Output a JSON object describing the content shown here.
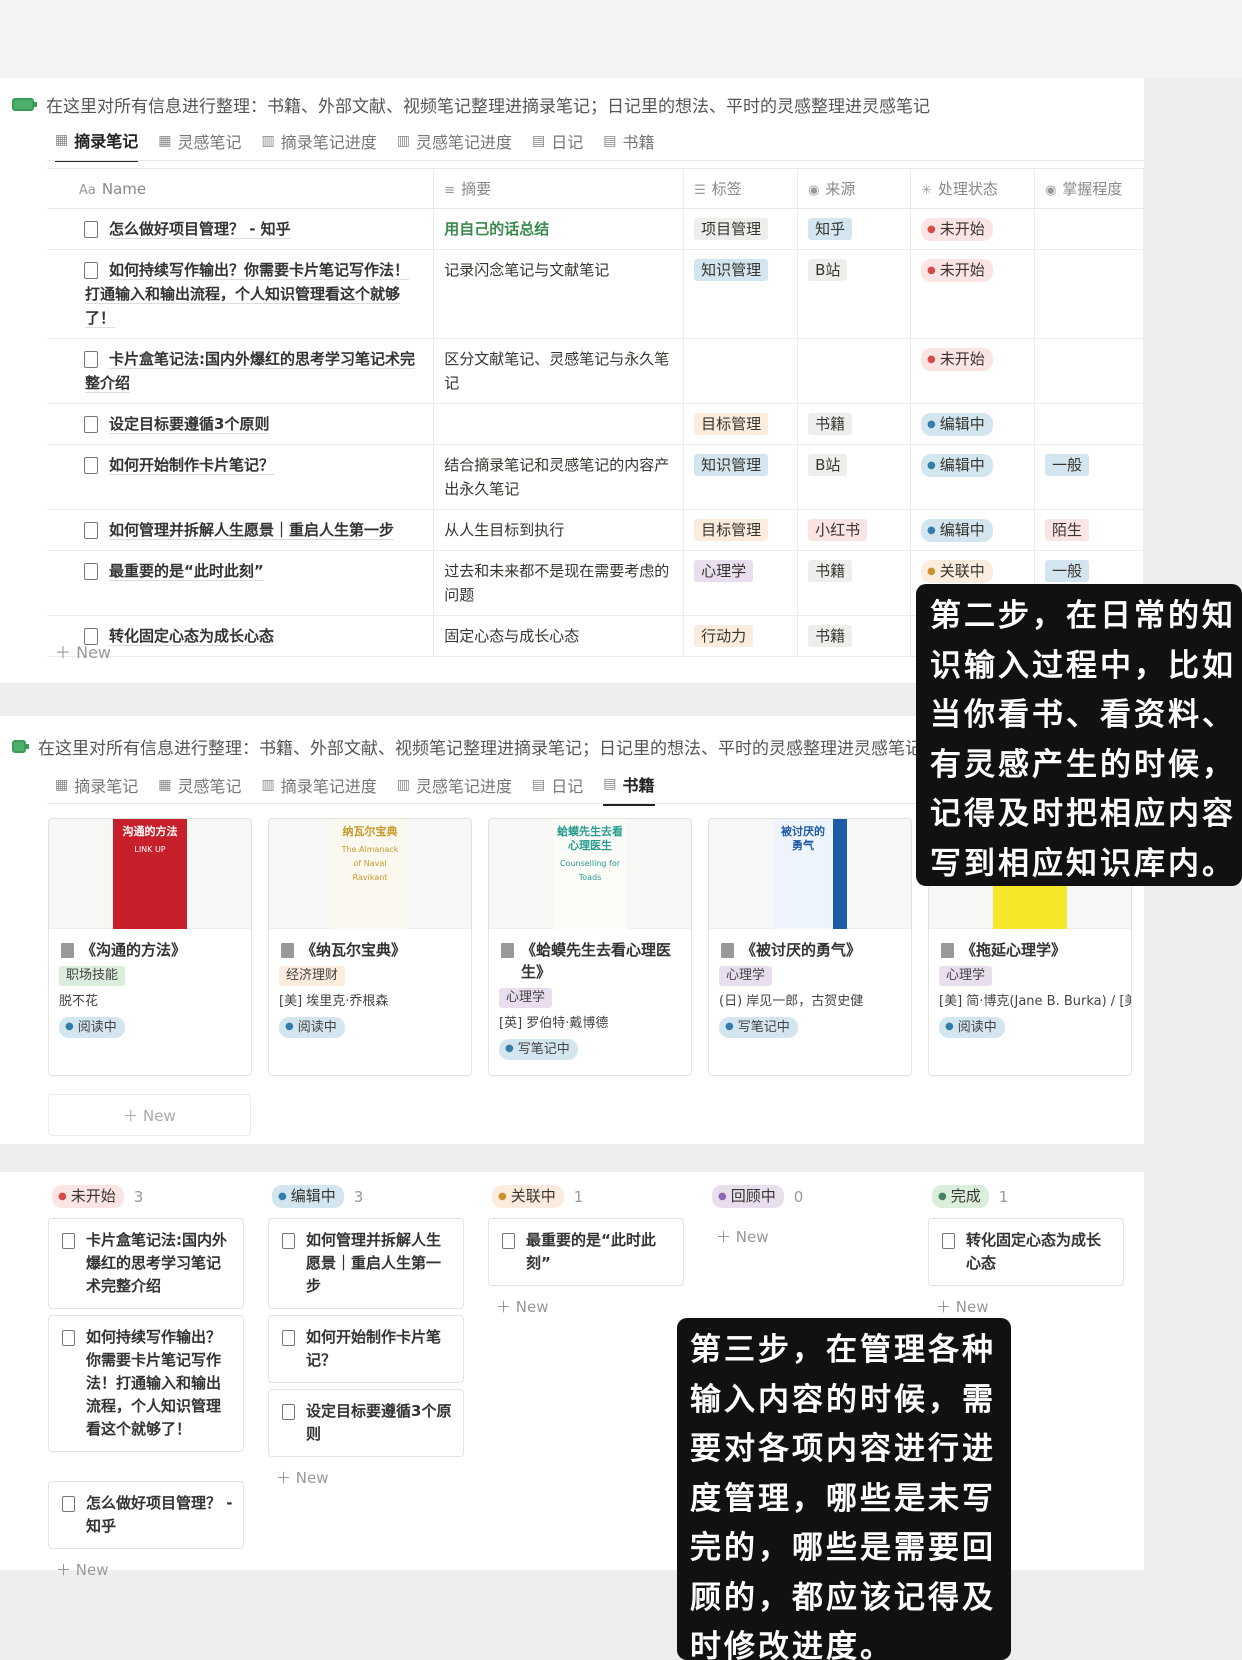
{
  "title": "在这里对所有信息进行整理：书籍、外部文献、视频笔记整理进摘录笔记；日记里的想法、平时的灵感整理进灵感笔记",
  "tabs": [
    {
      "label": "摘录笔记",
      "icon": "table-icon"
    },
    {
      "label": "灵感笔记",
      "icon": "table-icon"
    },
    {
      "label": "摘录笔记进度",
      "icon": "board-icon"
    },
    {
      "label": "灵感笔记进度",
      "icon": "board-icon"
    },
    {
      "label": "日记",
      "icon": "gallery-icon"
    },
    {
      "label": "书籍",
      "icon": "gallery-icon"
    }
  ],
  "table": {
    "headers": [
      "Name",
      "摘要",
      "标签",
      "来源",
      "处理状态",
      "掌握程度"
    ],
    "rows": [
      {
        "name": "怎么做好项目管理？ - 知乎",
        "summary": "用自己的话总结",
        "tag": "项目管理",
        "source": "知乎",
        "status": "未开始",
        "mastery": ""
      },
      {
        "name": "如何持续写作输出？你需要卡片笔记写作法！打通输入和输出流程，个人知识管理看这个就够了！",
        "summary": "记录闪念笔记与文献笔记",
        "tag": "知识管理",
        "source": "B站",
        "status": "未开始",
        "mastery": ""
      },
      {
        "name": "卡片盒笔记法:国内外爆红的思考学习笔记术完整介绍",
        "summary": "区分文献笔记、灵感笔记与永久笔记",
        "tag": "",
        "source": "",
        "status": "未开始",
        "mastery": ""
      },
      {
        "name": "设定目标要遵循3个原则",
        "summary": "",
        "tag": "目标管理",
        "source": "书籍",
        "status": "编辑中",
        "mastery": ""
      },
      {
        "name": "如何开始制作卡片笔记？",
        "summary": "结合摘录笔记和灵感笔记的内容产出永久笔记",
        "tag": "知识管理",
        "source": "B站",
        "status": "编辑中",
        "mastery": "一般"
      },
      {
        "name": "如何管理并拆解人生愿景｜重启人生第一步",
        "summary": "从人生目标到执行",
        "tag": "目标管理",
        "source": "小红书",
        "status": "编辑中",
        "mastery": "陌生"
      },
      {
        "name": "最重要的是“此时此刻”",
        "summary": "过去和未来都不是现在需要考虑的问题",
        "tag": "心理学",
        "source": "书籍",
        "status": "关联中",
        "mastery": "一般"
      },
      {
        "name": "转化固定心态为成长心态",
        "summary": "固定心态与成长心态",
        "tag": "行动力",
        "source": "书籍",
        "status": "",
        "mastery": ""
      }
    ],
    "new_label": "New"
  },
  "books": [
    {
      "name": "《沟通的方法》",
      "category": "职场技能",
      "author": "脱不花",
      "status": "阅读中",
      "cover_title": "沟通的方法",
      "cover_sub": "LINK UP"
    },
    {
      "name": "《纳瓦尔宝典》",
      "category": "经济理财",
      "author": "[美] 埃里克·乔根森",
      "status": "阅读中",
      "cover_title": "纳瓦尔宝典",
      "cover_sub": "The Almanack of Naval Ravikant"
    },
    {
      "name": "《蛤蟆先生去看心理医生》",
      "category": "心理学",
      "author": "[英] 罗伯特·戴博德",
      "status": "写笔记中",
      "cover_title": "蛤蟆先生去看心理医生",
      "cover_sub": "Counselling for Toads"
    },
    {
      "name": "《被讨厌的勇气》",
      "category": "心理学",
      "author": "(日) 岸见一郎，古贺史健",
      "status": "写笔记中",
      "cover_title": "被讨厌的勇气",
      "cover_sub": ""
    },
    {
      "name": "《拖延心理学》",
      "category": "心理学",
      "author": "[美] 简·博克(Jane B. Burka) / [美",
      "status": "阅读中",
      "cover_title": "",
      "cover_sub": ""
    }
  ],
  "gallery_new": "New",
  "board": [
    {
      "status": "未开始",
      "count": "3",
      "cards": [
        "卡片盒笔记法:国内外爆红的思考学习笔记术完整介绍",
        "如何持续写作输出？你需要卡片笔记写作法！打通输入和输出流程，个人知识管理看这个就够了！",
        "怎么做好项目管理？ - 知乎"
      ]
    },
    {
      "status": "编辑中",
      "count": "3",
      "cards": [
        "如何管理并拆解人生愿景｜重启人生第一步",
        "如何开始制作卡片笔记？",
        "设定目标要遵循3个原则"
      ]
    },
    {
      "status": "关联中",
      "count": "1",
      "cards": [
        "最重要的是“此时此刻”"
      ]
    },
    {
      "status": "回顾中",
      "count": "0",
      "cards": []
    },
    {
      "status": "完成",
      "count": "1",
      "cards": [
        "转化固定心态为成长心态"
      ]
    }
  ],
  "board_new": "New",
  "overlay_step2": [
    "第二步，在日常的知",
    "识输入过程中，比如",
    "当你看书、看资料、",
    "有灵感产生的时候，",
    "记得及时把相应内容",
    "写到相应知识库内。"
  ],
  "overlay_step3": [
    "第三步，在管理各种",
    "输入内容的时候，需",
    "要对各项内容进行进",
    "度管理，哪些是未写",
    "完的，哪些是需要回",
    "顾的，都应该记得及",
    "时修改进度。"
  ],
  "colors": {
    "status": {
      "未开始": [
        "#fbe4e4",
        "#d44c47"
      ],
      "编辑中": [
        "#d3e5ef",
        "#337ea9"
      ],
      "关联中": [
        "#fbecdd",
        "#cb912f"
      ],
      "回顾中": [
        "#e8deee",
        "#9065b0"
      ],
      "完成": [
        "#dbeddb",
        "#448361"
      ],
      "阅读中": [
        "#d3e5ef",
        "#337ea9"
      ],
      "写笔记中": [
        "#d3e5ef",
        "#337ea9"
      ]
    },
    "tag": {
      "项目管理": "#eeeeec",
      "知识管理": "#d3e5ef",
      "目标管理": "#fbecdd",
      "心理学": "#e8deee",
      "行动力": "#fbecdd",
      "知乎": "#d3e5ef",
      "B站": "#eeeeec",
      "书籍": "#eeeeec",
      "小红书": "#fbe4e4",
      "一般": "#d3e5ef",
      "陌生": "#fbe4e4",
      "职场技能": "#dbeddb",
      "经济理财": "#fbecdd"
    }
  }
}
